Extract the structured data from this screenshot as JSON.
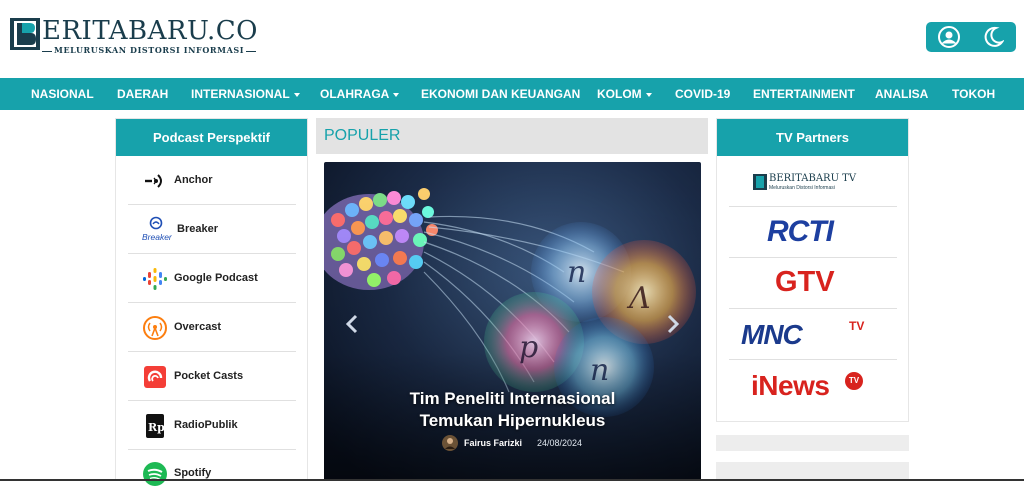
{
  "brand": {
    "name": "ERITABARU.CO",
    "tagline": "MELURUSKAN DISTORSI INFORMASI",
    "color": "#17a2ab"
  },
  "header": {
    "user_icon": "user-circle-icon",
    "theme_icon": "moon-icon"
  },
  "nav": {
    "items": [
      {
        "label": "NASIONAL",
        "dropdown": false
      },
      {
        "label": "DAERAH",
        "dropdown": false
      },
      {
        "label": "INTERNASIONAL",
        "dropdown": true
      },
      {
        "label": "OLAHRAGA",
        "dropdown": true
      },
      {
        "label": "EKONOMI DAN KEUANGAN",
        "dropdown": false
      },
      {
        "label": "KOLOM",
        "dropdown": true
      },
      {
        "label": "COVID-19",
        "dropdown": false
      },
      {
        "label": "ENTERTAINMENT",
        "dropdown": false
      },
      {
        "label": "ANALISA",
        "dropdown": false
      },
      {
        "label": "TOKOH",
        "dropdown": false
      }
    ]
  },
  "podcast": {
    "title": "Podcast Perspektif",
    "items": [
      {
        "label": "Anchor",
        "icon": "anchor-icon"
      },
      {
        "label": "Breaker",
        "icon": "breaker-icon",
        "icon_text": "Breaker"
      },
      {
        "label": "Google Podcast",
        "icon": "google-podcast-icon"
      },
      {
        "label": "Overcast",
        "icon": "overcast-icon"
      },
      {
        "label": "Pocket Casts",
        "icon": "pocket-casts-icon"
      },
      {
        "label": "RadioPublik",
        "icon": "radiopublik-icon",
        "icon_text": "Rp"
      },
      {
        "label": "Spotify",
        "icon": "spotify-icon"
      }
    ]
  },
  "populer": {
    "title": "POPULER",
    "slide": {
      "title_line1": "Tim Peneliti Internasional",
      "title_line2": "Temukan Hipernukleus",
      "author": "Fairus Farizki",
      "date": "24/08/2024"
    }
  },
  "partners": {
    "title": "TV Partners",
    "items": [
      {
        "name": "BERITABARU TV",
        "tagline": "Meluruskan Distorsi Informasi"
      },
      {
        "name": "RCTI"
      },
      {
        "name": "GTV"
      },
      {
        "name": "MNC",
        "suffix": "TV"
      },
      {
        "name": "iNews",
        "suffix": "TV"
      }
    ]
  }
}
